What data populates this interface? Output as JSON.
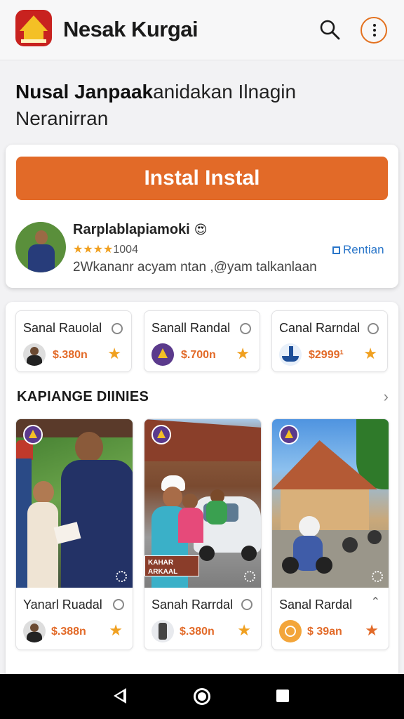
{
  "app": {
    "title": "Nesak Kurgai",
    "logo_icon": "temple-logo-icon",
    "search_icon": "search-icon",
    "menu_icon": "more-vertical-icon",
    "accent_color": "#e26a28"
  },
  "headline": {
    "bold": "Nusal Janpaak",
    "rest": "anidakan Ilnagin",
    "line2": "Neranirran"
  },
  "install": {
    "button_label": "Instal Instal"
  },
  "review": {
    "name": "Rarplablapiamoki",
    "emoji": "😍",
    "stars": "★★★★",
    "rating_text": "1004",
    "text": "2Wkananr acyam ntan ,@yam talkanlaan",
    "link_label": "Rentian"
  },
  "mini_cards": [
    {
      "title": "Sanal Rauolal",
      "price": "$.380n"
    },
    {
      "title": "Sanall Randal",
      "price": "$.700n"
    },
    {
      "title": "Canal Rarndal",
      "price": "$2999¹"
    }
  ],
  "section": {
    "title": "KAPIANGE DIINIES",
    "chevron": "›"
  },
  "big_cards": [
    {
      "title": "Yanarl Ruadal",
      "price": "$.388n",
      "sign_text": ""
    },
    {
      "title": "Sanah Rarrdal",
      "price": "$.380n",
      "sign_text": "KAHAR ARKAAL"
    },
    {
      "title": "Sanal Rardal",
      "price": "$ 39an",
      "sign_text": ""
    }
  ],
  "system_nav": {
    "back_icon": "back-triangle-icon",
    "home_icon": "home-circle-icon",
    "recents_icon": "recents-square-icon"
  }
}
